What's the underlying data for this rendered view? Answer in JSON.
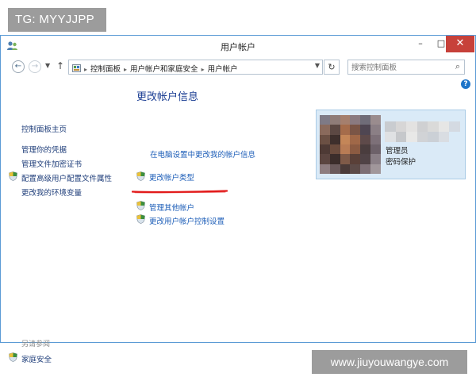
{
  "overlay": {
    "tag_text": "TG: MYYJJPP",
    "watermark_text": "www.jiuyouwangye.com"
  },
  "window": {
    "title": "用户帐户",
    "controls": {
      "minimize": "–",
      "maximize": "□",
      "close": "✕"
    }
  },
  "address_bar": {
    "breadcrumbs": [
      "控制面板",
      "用户帐户和家庭安全",
      "用户帐户"
    ],
    "search_placeholder": "搜索控制面板"
  },
  "sidebar": {
    "home": "控制面板主页",
    "links": [
      {
        "label": "管理你的凭据",
        "icon": ""
      },
      {
        "label": "管理文件加密证书",
        "icon": ""
      },
      {
        "label": "配置高级用户配置文件属性",
        "icon": "shield-icon"
      },
      {
        "label": "更改我的环境变量",
        "icon": ""
      }
    ],
    "see_also_label": "另请参阅",
    "see_also_links": [
      {
        "label": "家庭安全",
        "icon": "shield-icon"
      }
    ]
  },
  "main": {
    "heading": "更改帐户信息",
    "pc_settings_link": "在电脑设置中更改我的帐户信息",
    "change_type_link": "更改帐户类型",
    "manage_other_link": "管理其他帐户",
    "uac_settings_link": "更改用户帐户控制设置"
  },
  "account_card": {
    "type": "管理员",
    "password_status": "密码保护"
  },
  "colors": {
    "window_border": "#5b9bd5",
    "link_blue": "#1d5eb8",
    "heading_blue": "#1c3f94",
    "card_bg": "#daeaf7",
    "close_red": "#c7413a",
    "annotation_red": "#e21b1b"
  }
}
